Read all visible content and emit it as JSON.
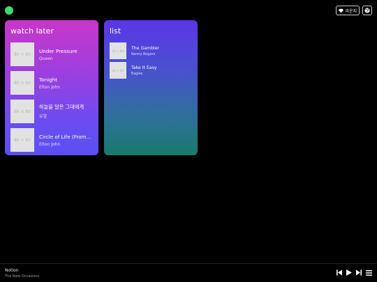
{
  "header": {
    "lounge_label": "라운지"
  },
  "watch_later": {
    "title": "watch later",
    "items": [
      {
        "thumb": "80 × 80",
        "song": "Under Pressure",
        "artist": "Queen"
      },
      {
        "thumb": "80 × 80",
        "song": "Tonight",
        "artist": "Elton John"
      },
      {
        "thumb": "80 × 80",
        "song": "하늘을 달은 그대에게",
        "artist": "유열"
      },
      {
        "thumb": "80 × 80",
        "song": "Circle of Life (From…",
        "artist": "Elton John"
      }
    ]
  },
  "list": {
    "title": "list",
    "items": [
      {
        "thumb": "80 × 80",
        "song": "The Gambler",
        "artist": "Kenny Rogers"
      },
      {
        "thumb": "80 × 80",
        "song": "Take It Easy",
        "artist": "Eagles"
      }
    ]
  },
  "player": {
    "title": "Notion",
    "artist": "The Rare Occasions"
  },
  "colors": {
    "status_dot": "#3ddc6b",
    "watch_later_gradient": [
      "#c936c9",
      "#5b4ff2"
    ],
    "list_gradient": [
      "#5b35e8",
      "#187a6c"
    ]
  },
  "icons": [
    "diamond-icon",
    "globe-icon",
    "previous-icon",
    "play-icon",
    "next-icon",
    "menu-icon"
  ]
}
